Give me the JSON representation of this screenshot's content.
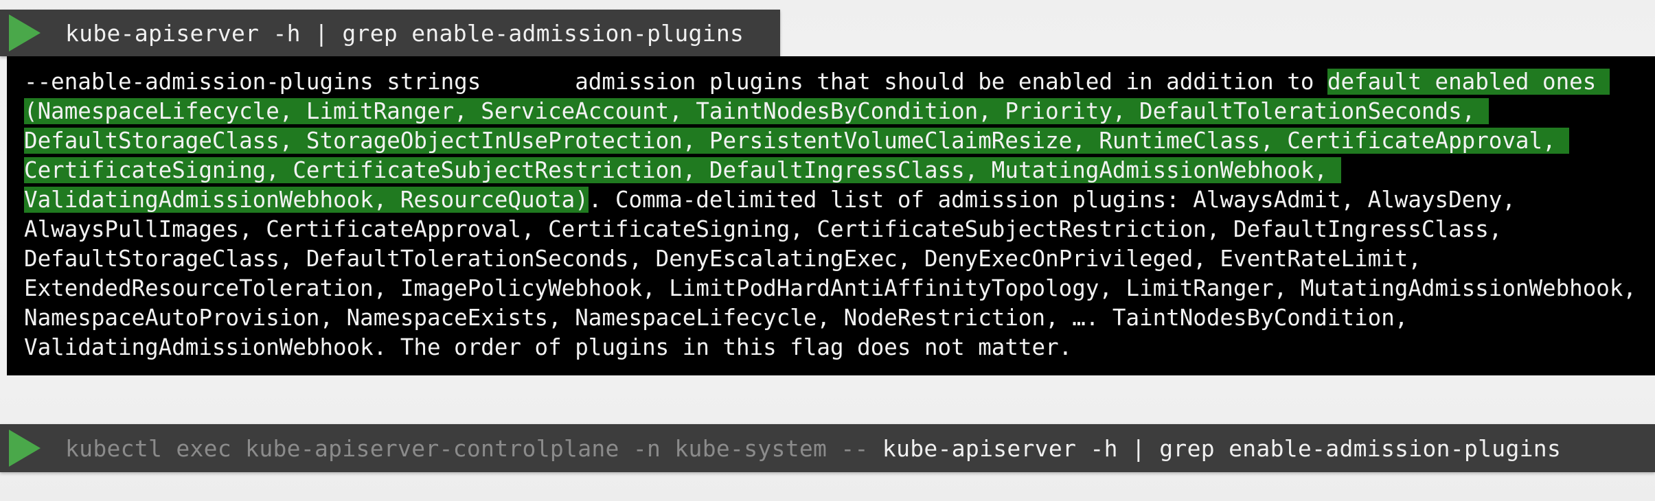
{
  "command_top": {
    "play_icon": "play-icon",
    "text": "kube-apiserver -h | grep enable-admission-plugins"
  },
  "output": {
    "lines": [
      {
        "plain": "--enable-admission-plugins strings       admission plugins that should be enabled in addition to ",
        "highlight": "default enabled ones ",
        "after": ""
      },
      {
        "plain": "",
        "highlight": "(NamespaceLifecycle, LimitRanger, ServiceAccount, TaintNodesByCondition, Priority, DefaultTolerationSeconds, ",
        "after": ""
      },
      {
        "plain": "",
        "highlight": "DefaultStorageClass, StorageObjectInUseProtection, PersistentVolumeClaimResize, RuntimeClass, CertificateApproval, ",
        "after": ""
      },
      {
        "plain": "",
        "highlight": "CertificateSigning, CertificateSubjectRestriction, DefaultIngressClass, MutatingAdmissionWebhook, ",
        "after": ""
      },
      {
        "plain": "",
        "highlight": "ValidatingAdmissionWebhook, ResourceQuota)",
        "after": ". Comma-delimited list of admission plugins: AlwaysAdmit, AlwaysDeny,"
      },
      {
        "plain": "AlwaysPullImages, CertificateApproval, CertificateSigning, CertificateSubjectRestriction, DefaultIngressClass,",
        "highlight": "",
        "after": ""
      },
      {
        "plain": "DefaultStorageClass, DefaultTolerationSeconds, DenyEscalatingExec, DenyExecOnPrivileged, EventRateLimit,",
        "highlight": "",
        "after": ""
      },
      {
        "plain": "ExtendedResourceToleration, ImagePolicyWebhook, LimitPodHardAntiAffinityTopology, LimitRanger, MutatingAdmissionWebhook,",
        "highlight": "",
        "after": ""
      },
      {
        "plain": "NamespaceAutoProvision, NamespaceExists, NamespaceLifecycle, NodeRestriction, …. TaintNodesByCondition,",
        "highlight": "",
        "after": ""
      },
      {
        "plain": "ValidatingAdmissionWebhook. The order of plugins in this flag does not matter.",
        "highlight": "",
        "after": ""
      }
    ],
    "highlight_color": "#207a20"
  },
  "command_bottom": {
    "play_icon": "play-icon",
    "dim_text": "kubectl exec kube-apiserver-controlplane -n kube-system -- ",
    "text": "kube-apiserver -h | grep enable-admission-plugins"
  }
}
